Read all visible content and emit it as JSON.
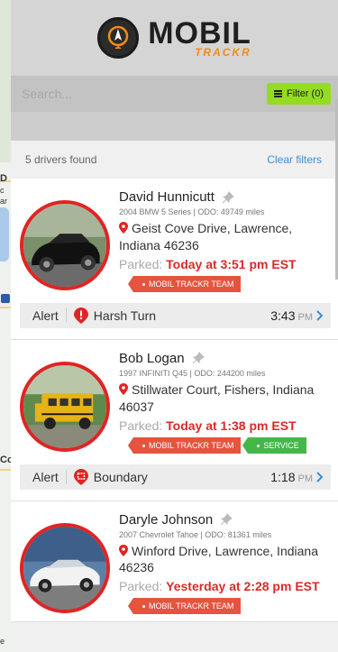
{
  "map": {
    "labels": [
      "D",
      "c",
      "ar",
      "Co",
      "e"
    ]
  },
  "header": {
    "logo_main": "MOBIL",
    "logo_sub": "TRACKR"
  },
  "search": {
    "placeholder": "Search...",
    "filter_label": "Filter (0)"
  },
  "results": {
    "count_text": "5 drivers found",
    "clear_label": "Clear filters"
  },
  "drivers": [
    {
      "name": "David Hunnicutt",
      "vehicle": "2004 BMW 5 Series | ODO: 49749 miles",
      "address": "Geist Cove Drive, Lawrence, Indiana 46236",
      "parked_label": "Parked:",
      "parked_time": "Today at 3:51 pm EST",
      "tags": [
        "MOBIL TRACKR TEAM"
      ],
      "alert": {
        "label": "Alert",
        "type": "Harsh Turn",
        "time": "3:43",
        "ampm": "PM"
      }
    },
    {
      "name": "Bob Logan",
      "vehicle": "1997 INFINITI Q45 | ODO: 244200 miles",
      "address": "Stillwater Court, Fishers, Indiana 46037",
      "parked_label": "Parked:",
      "parked_time": "Today at 1:38 pm EST",
      "tags": [
        "MOBIL TRACKR TEAM",
        "SERVICE"
      ],
      "alert": {
        "label": "Alert",
        "type": "Boundary",
        "time": "1:18",
        "ampm": "PM"
      }
    },
    {
      "name": "Daryle Johnson",
      "vehicle": "2007 Chevrolet Tahoe | ODO: 81361 miles",
      "address": "Winford Drive, Lawrence, Indiana 46236",
      "parked_label": "Parked:",
      "parked_time": "Yesterday at 2:28 pm EST",
      "tags": [
        "MOBIL TRACKR TEAM"
      ]
    }
  ],
  "colors": {
    "accent_red": "#e02424",
    "filter_green": "#93dc22",
    "link_blue": "#3a8fd6",
    "tag_red": "#e5543e",
    "tag_green": "#45b64a"
  }
}
